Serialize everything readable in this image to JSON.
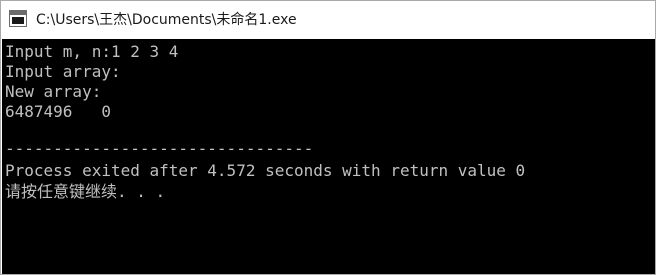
{
  "window": {
    "title": "C:\\Users\\王杰\\Documents\\未命名1.exe",
    "icon": "console-app-icon"
  },
  "console": {
    "lines": [
      "Input m, n:1 2 3 4",
      "Input array:",
      "New array:",
      "6487496   0",
      "--------------------------------",
      "Process exited after 4.572 seconds with return value 0",
      "请按任意键继续. . ."
    ],
    "text_color": "#c0c0c0",
    "background": "#000000"
  }
}
